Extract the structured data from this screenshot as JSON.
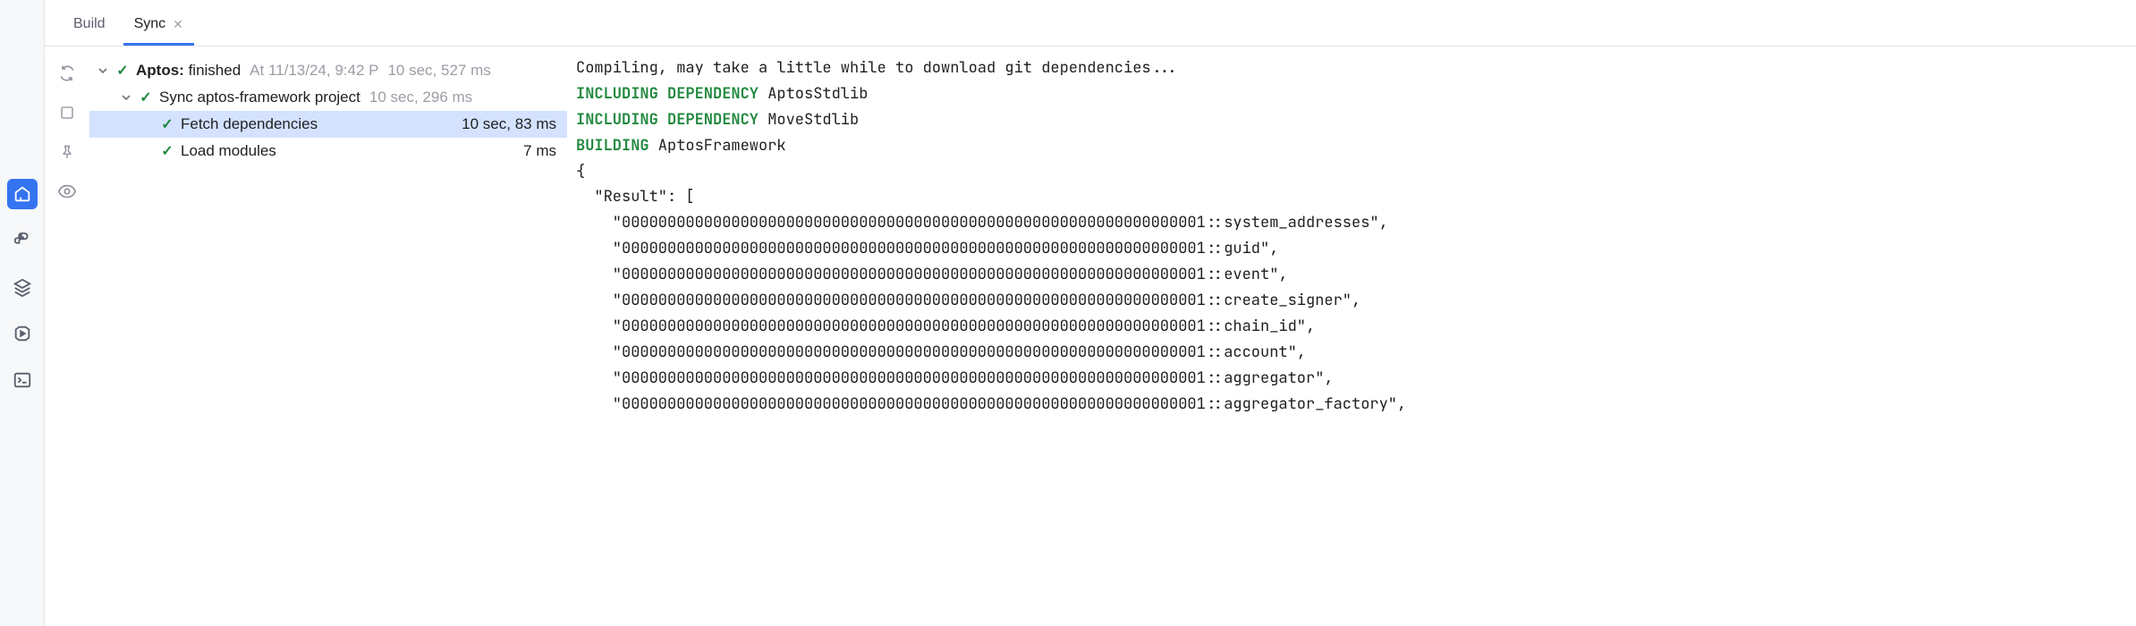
{
  "tabs": {
    "build": "Build",
    "sync": "Sync"
  },
  "tree": {
    "root": {
      "prefix": "Aptos:",
      "status": "finished",
      "timestamp": "At 11/13/24, 9:42 P",
      "duration": "10 sec, 527 ms"
    },
    "sync_project": {
      "label": "Sync aptos-framework project",
      "duration": "10 sec, 296 ms"
    },
    "fetch_deps": {
      "label": "Fetch dependencies",
      "duration": "10 sec, 83 ms"
    },
    "load_modules": {
      "label": "Load modules",
      "duration": "7 ms"
    }
  },
  "console": {
    "line1": "Compiling, may take a little while to download git dependencies...",
    "inc_dep": "INCLUDING DEPENDENCY",
    "dep1": " AptosStdlib",
    "dep2": " MoveStdlib",
    "building": "BUILDING",
    "building_target": " AptosFramework",
    "brace_open": "{",
    "result_key": "  \"Result\": [",
    "r1": "    \"0000000000000000000000000000000000000000000000000000000000000001::system_addresses\",",
    "r2": "    \"0000000000000000000000000000000000000000000000000000000000000001::guid\",",
    "r3": "    \"0000000000000000000000000000000000000000000000000000000000000001::event\",",
    "r4": "    \"0000000000000000000000000000000000000000000000000000000000000001::create_signer\",",
    "r5": "    \"0000000000000000000000000000000000000000000000000000000000000001::chain_id\",",
    "r6": "    \"0000000000000000000000000000000000000000000000000000000000000001::account\",",
    "r7": "    \"0000000000000000000000000000000000000000000000000000000000000001::aggregator\",",
    "r8": "    \"0000000000000000000000000000000000000000000000000000000000000001::aggregator_factory\","
  }
}
